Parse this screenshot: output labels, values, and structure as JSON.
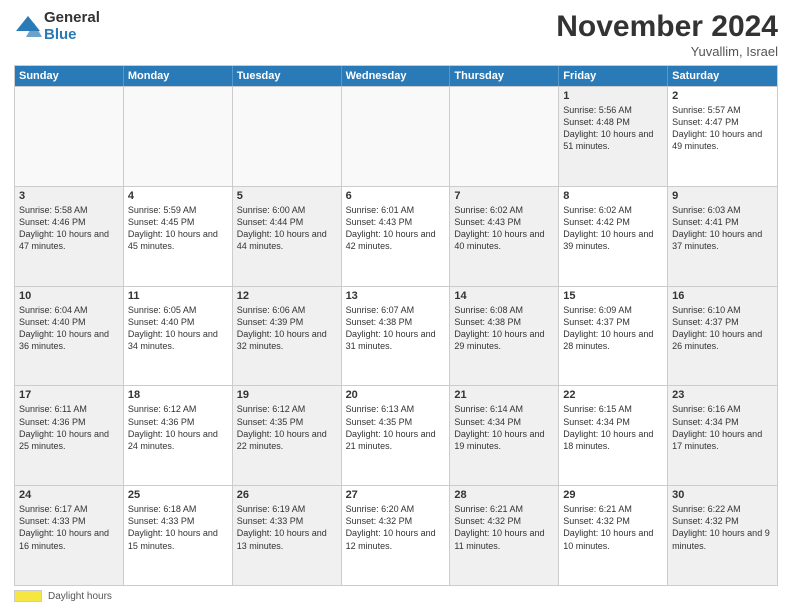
{
  "logo": {
    "general": "General",
    "blue": "Blue"
  },
  "header": {
    "month": "November 2024",
    "location": "Yuvallim, Israel"
  },
  "days_of_week": [
    "Sunday",
    "Monday",
    "Tuesday",
    "Wednesday",
    "Thursday",
    "Friday",
    "Saturday"
  ],
  "footer": {
    "daylight_label": "Daylight hours"
  },
  "weeks": [
    {
      "cells": [
        {
          "day": "",
          "content": "",
          "empty": true
        },
        {
          "day": "",
          "content": "",
          "empty": true
        },
        {
          "day": "",
          "content": "",
          "empty": true
        },
        {
          "day": "",
          "content": "",
          "empty": true
        },
        {
          "day": "",
          "content": "",
          "empty": true
        },
        {
          "day": "1",
          "content": "Sunrise: 5:56 AM\nSunset: 4:48 PM\nDaylight: 10 hours and 51 minutes.",
          "empty": false,
          "shaded": true
        },
        {
          "day": "2",
          "content": "Sunrise: 5:57 AM\nSunset: 4:47 PM\nDaylight: 10 hours and 49 minutes.",
          "empty": false,
          "shaded": false
        }
      ]
    },
    {
      "cells": [
        {
          "day": "3",
          "content": "Sunrise: 5:58 AM\nSunset: 4:46 PM\nDaylight: 10 hours and 47 minutes.",
          "empty": false,
          "shaded": true
        },
        {
          "day": "4",
          "content": "Sunrise: 5:59 AM\nSunset: 4:45 PM\nDaylight: 10 hours and 45 minutes.",
          "empty": false,
          "shaded": false
        },
        {
          "day": "5",
          "content": "Sunrise: 6:00 AM\nSunset: 4:44 PM\nDaylight: 10 hours and 44 minutes.",
          "empty": false,
          "shaded": true
        },
        {
          "day": "6",
          "content": "Sunrise: 6:01 AM\nSunset: 4:43 PM\nDaylight: 10 hours and 42 minutes.",
          "empty": false,
          "shaded": false
        },
        {
          "day": "7",
          "content": "Sunrise: 6:02 AM\nSunset: 4:43 PM\nDaylight: 10 hours and 40 minutes.",
          "empty": false,
          "shaded": true
        },
        {
          "day": "8",
          "content": "Sunrise: 6:02 AM\nSunset: 4:42 PM\nDaylight: 10 hours and 39 minutes.",
          "empty": false,
          "shaded": false
        },
        {
          "day": "9",
          "content": "Sunrise: 6:03 AM\nSunset: 4:41 PM\nDaylight: 10 hours and 37 minutes.",
          "empty": false,
          "shaded": true
        }
      ]
    },
    {
      "cells": [
        {
          "day": "10",
          "content": "Sunrise: 6:04 AM\nSunset: 4:40 PM\nDaylight: 10 hours and 36 minutes.",
          "empty": false,
          "shaded": true
        },
        {
          "day": "11",
          "content": "Sunrise: 6:05 AM\nSunset: 4:40 PM\nDaylight: 10 hours and 34 minutes.",
          "empty": false,
          "shaded": false
        },
        {
          "day": "12",
          "content": "Sunrise: 6:06 AM\nSunset: 4:39 PM\nDaylight: 10 hours and 32 minutes.",
          "empty": false,
          "shaded": true
        },
        {
          "day": "13",
          "content": "Sunrise: 6:07 AM\nSunset: 4:38 PM\nDaylight: 10 hours and 31 minutes.",
          "empty": false,
          "shaded": false
        },
        {
          "day": "14",
          "content": "Sunrise: 6:08 AM\nSunset: 4:38 PM\nDaylight: 10 hours and 29 minutes.",
          "empty": false,
          "shaded": true
        },
        {
          "day": "15",
          "content": "Sunrise: 6:09 AM\nSunset: 4:37 PM\nDaylight: 10 hours and 28 minutes.",
          "empty": false,
          "shaded": false
        },
        {
          "day": "16",
          "content": "Sunrise: 6:10 AM\nSunset: 4:37 PM\nDaylight: 10 hours and 26 minutes.",
          "empty": false,
          "shaded": true
        }
      ]
    },
    {
      "cells": [
        {
          "day": "17",
          "content": "Sunrise: 6:11 AM\nSunset: 4:36 PM\nDaylight: 10 hours and 25 minutes.",
          "empty": false,
          "shaded": true
        },
        {
          "day": "18",
          "content": "Sunrise: 6:12 AM\nSunset: 4:36 PM\nDaylight: 10 hours and 24 minutes.",
          "empty": false,
          "shaded": false
        },
        {
          "day": "19",
          "content": "Sunrise: 6:12 AM\nSunset: 4:35 PM\nDaylight: 10 hours and 22 minutes.",
          "empty": false,
          "shaded": true
        },
        {
          "day": "20",
          "content": "Sunrise: 6:13 AM\nSunset: 4:35 PM\nDaylight: 10 hours and 21 minutes.",
          "empty": false,
          "shaded": false
        },
        {
          "day": "21",
          "content": "Sunrise: 6:14 AM\nSunset: 4:34 PM\nDaylight: 10 hours and 19 minutes.",
          "empty": false,
          "shaded": true
        },
        {
          "day": "22",
          "content": "Sunrise: 6:15 AM\nSunset: 4:34 PM\nDaylight: 10 hours and 18 minutes.",
          "empty": false,
          "shaded": false
        },
        {
          "day": "23",
          "content": "Sunrise: 6:16 AM\nSunset: 4:34 PM\nDaylight: 10 hours and 17 minutes.",
          "empty": false,
          "shaded": true
        }
      ]
    },
    {
      "cells": [
        {
          "day": "24",
          "content": "Sunrise: 6:17 AM\nSunset: 4:33 PM\nDaylight: 10 hours and 16 minutes.",
          "empty": false,
          "shaded": true
        },
        {
          "day": "25",
          "content": "Sunrise: 6:18 AM\nSunset: 4:33 PM\nDaylight: 10 hours and 15 minutes.",
          "empty": false,
          "shaded": false
        },
        {
          "day": "26",
          "content": "Sunrise: 6:19 AM\nSunset: 4:33 PM\nDaylight: 10 hours and 13 minutes.",
          "empty": false,
          "shaded": true
        },
        {
          "day": "27",
          "content": "Sunrise: 6:20 AM\nSunset: 4:32 PM\nDaylight: 10 hours and 12 minutes.",
          "empty": false,
          "shaded": false
        },
        {
          "day": "28",
          "content": "Sunrise: 6:21 AM\nSunset: 4:32 PM\nDaylight: 10 hours and 11 minutes.",
          "empty": false,
          "shaded": true
        },
        {
          "day": "29",
          "content": "Sunrise: 6:21 AM\nSunset: 4:32 PM\nDaylight: 10 hours and 10 minutes.",
          "empty": false,
          "shaded": false
        },
        {
          "day": "30",
          "content": "Sunrise: 6:22 AM\nSunset: 4:32 PM\nDaylight: 10 hours and 9 minutes.",
          "empty": false,
          "shaded": true
        }
      ]
    }
  ]
}
